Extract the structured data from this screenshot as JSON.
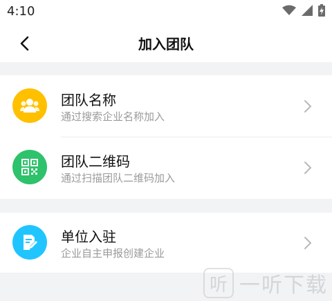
{
  "status": {
    "time": "4:10"
  },
  "nav": {
    "title": "加入团队"
  },
  "options": [
    {
      "title": "团队名称",
      "subtitle": "通过搜索企业名称加入",
      "icon": "team-icon",
      "color": "#FFC000"
    },
    {
      "title": "团队二维码",
      "subtitle": "通过扫描团队二维码加入",
      "icon": "qr-code-icon",
      "color": "#2DC26B"
    },
    {
      "title": "单位入驻",
      "subtitle": "企业自主申报创建企业",
      "icon": "edit-document-icon",
      "color": "#20C5FF"
    }
  ],
  "watermark": {
    "text": "一听下载",
    "badge": "听"
  }
}
